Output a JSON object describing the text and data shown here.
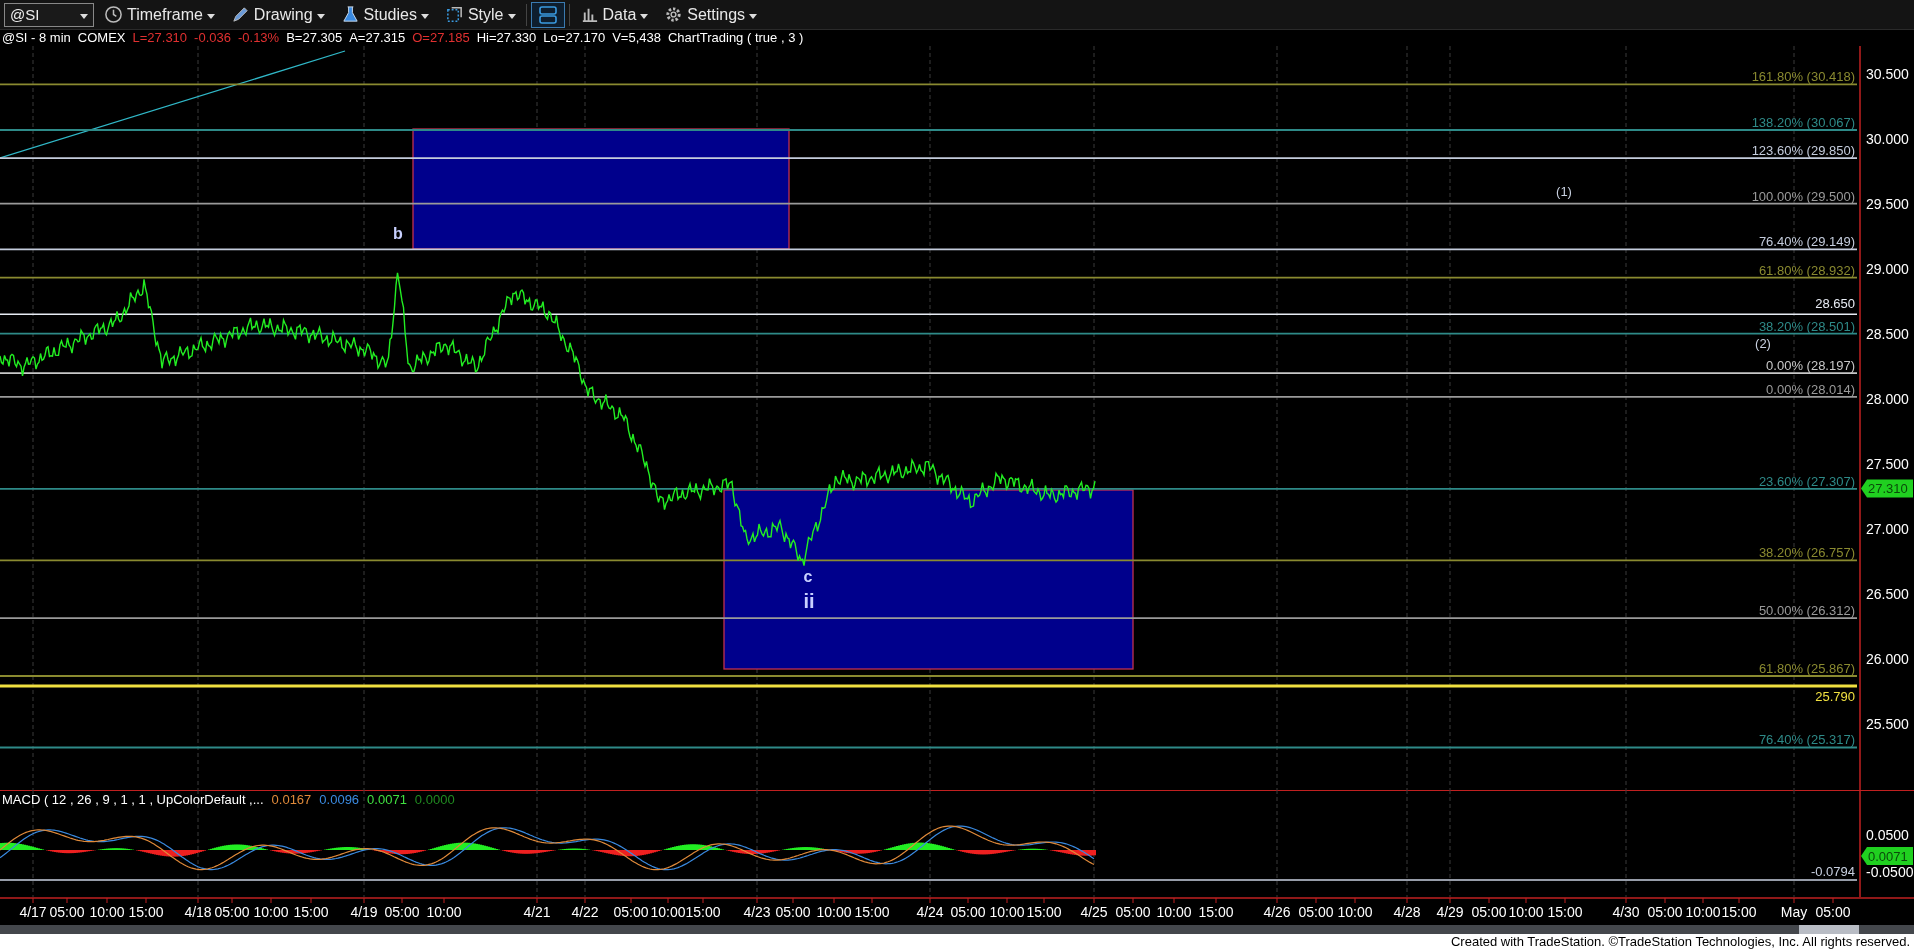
{
  "toolbar": {
    "symbol": "@SI",
    "buttons": [
      {
        "label": "Timeframe",
        "kind": "clock",
        "selected": false
      },
      {
        "label": "Drawing",
        "kind": "pencil",
        "selected": false
      },
      {
        "label": "Studies",
        "kind": "flask",
        "selected": false
      },
      {
        "label": "Style",
        "kind": "square",
        "selected": false
      },
      {
        "kind": "layout",
        "selected": true
      },
      {
        "label": "Data",
        "kind": "bars",
        "selected": false
      },
      {
        "label": "Settings",
        "kind": "gear",
        "selected": false
      }
    ]
  },
  "info_line": [
    {
      "text": "@SI - 8 min",
      "color": "#ffffff"
    },
    {
      "text": "COMEX",
      "color": "#ffffff"
    },
    {
      "text": "L=27.310",
      "color": "#e03030"
    },
    {
      "text": "-0.036",
      "color": "#e03030"
    },
    {
      "text": "-0.13%",
      "color": "#e03030"
    },
    {
      "text": "B=27.305",
      "color": "#ffffff"
    },
    {
      "text": "A=27.315",
      "color": "#ffffff"
    },
    {
      "text": "O=27.185",
      "color": "#e03030"
    },
    {
      "text": "Hi=27.330",
      "color": "#ffffff"
    },
    {
      "text": "Lo=27.170",
      "color": "#ffffff"
    },
    {
      "text": "V=5,438",
      "color": "#ffffff"
    },
    {
      "text": "ChartTrading ( true , 3 )",
      "color": "#ffffff"
    }
  ],
  "price_chart": {
    "fib_levels": [
      {
        "label": "161.80% (30.418)",
        "color": "#8a8a30"
      },
      {
        "label": "138.20% (30.067)",
        "color": "#2e8a88"
      },
      {
        "label": "123.60% (29.850)",
        "color": "#c4ccdc"
      },
      {
        "label": "100.00% (29.500)",
        "color": "#9a9a9a"
      },
      {
        "label": "76.40% (29.149)",
        "color": "#c4ccdc"
      },
      {
        "label": "61.80% (28.932)",
        "color": "#8a8a30"
      },
      {
        "label": "38.20% (28.501)",
        "color": "#2e8a88"
      },
      {
        "label": "0.00% (28.197)",
        "color": "#c8c8c8"
      },
      {
        "label": "0.00% (28.014)",
        "color": "#9a9a9a"
      },
      {
        "label": "23.60% (27.307)",
        "color": "#2e8a88"
      },
      {
        "label": "38.20% (26.757)",
        "color": "#8a8a30"
      },
      {
        "label": "50.00% (26.312)",
        "color": "#9a9a9a"
      },
      {
        "label": "61.80% (25.867)",
        "color": "#8a8a30"
      },
      {
        "label": "76.40% (25.317)",
        "color": "#2e8a88"
      }
    ],
    "price_lines": [
      {
        "label": "28.650",
        "color": "#e8ecf4"
      },
      {
        "label": "25.790",
        "color": "#f0e040"
      }
    ],
    "wave_labels": [
      "b",
      "c",
      "ii",
      "(1)",
      "(2)"
    ],
    "y_axis": [
      "30.500",
      "30.000",
      "29.500",
      "29.000",
      "28.500",
      "28.000",
      "27.500",
      "27.000",
      "26.500",
      "26.000",
      "25.500"
    ],
    "last_price": "27.310"
  },
  "macd": {
    "title": "MACD ( 12 , 26 , 9 , 1 , 1 , UpColorDefault ,...",
    "values": [
      {
        "text": "0.0167",
        "color": "#e08a3a"
      },
      {
        "text": "0.0096",
        "color": "#3a8ae0"
      },
      {
        "text": "0.0071",
        "color": "#40e040"
      },
      {
        "text": "0.0000",
        "color": "#208a20"
      }
    ],
    "y_axis": [
      "0.0500",
      "-0.0500"
    ],
    "line_label": "-0.0794",
    "last_value": "0.0071"
  },
  "time_axis": [
    "4/17",
    "05:00",
    "10:00",
    "15:00",
    "4/18",
    "05:00",
    "10:00",
    "15:00",
    "4/19",
    "05:00",
    "10:00",
    "4/21",
    "4/22",
    "05:00",
    "10:00",
    "15:00",
    "4/23",
    "05:00",
    "10:00",
    "15:00",
    "4/24",
    "05:00",
    "10:00",
    "15:00",
    "4/25",
    "05:00",
    "10:00",
    "15:00",
    "4/26",
    "05:00",
    "10:00",
    "4/28",
    "4/29",
    "05:00",
    "10:00",
    "15:00",
    "4/30",
    "05:00",
    "10:00",
    "15:00",
    "May",
    "05:00"
  ],
  "footer": "Created with TradeStation. ©TradeStation Technologies, Inc. All rights reserved."
}
